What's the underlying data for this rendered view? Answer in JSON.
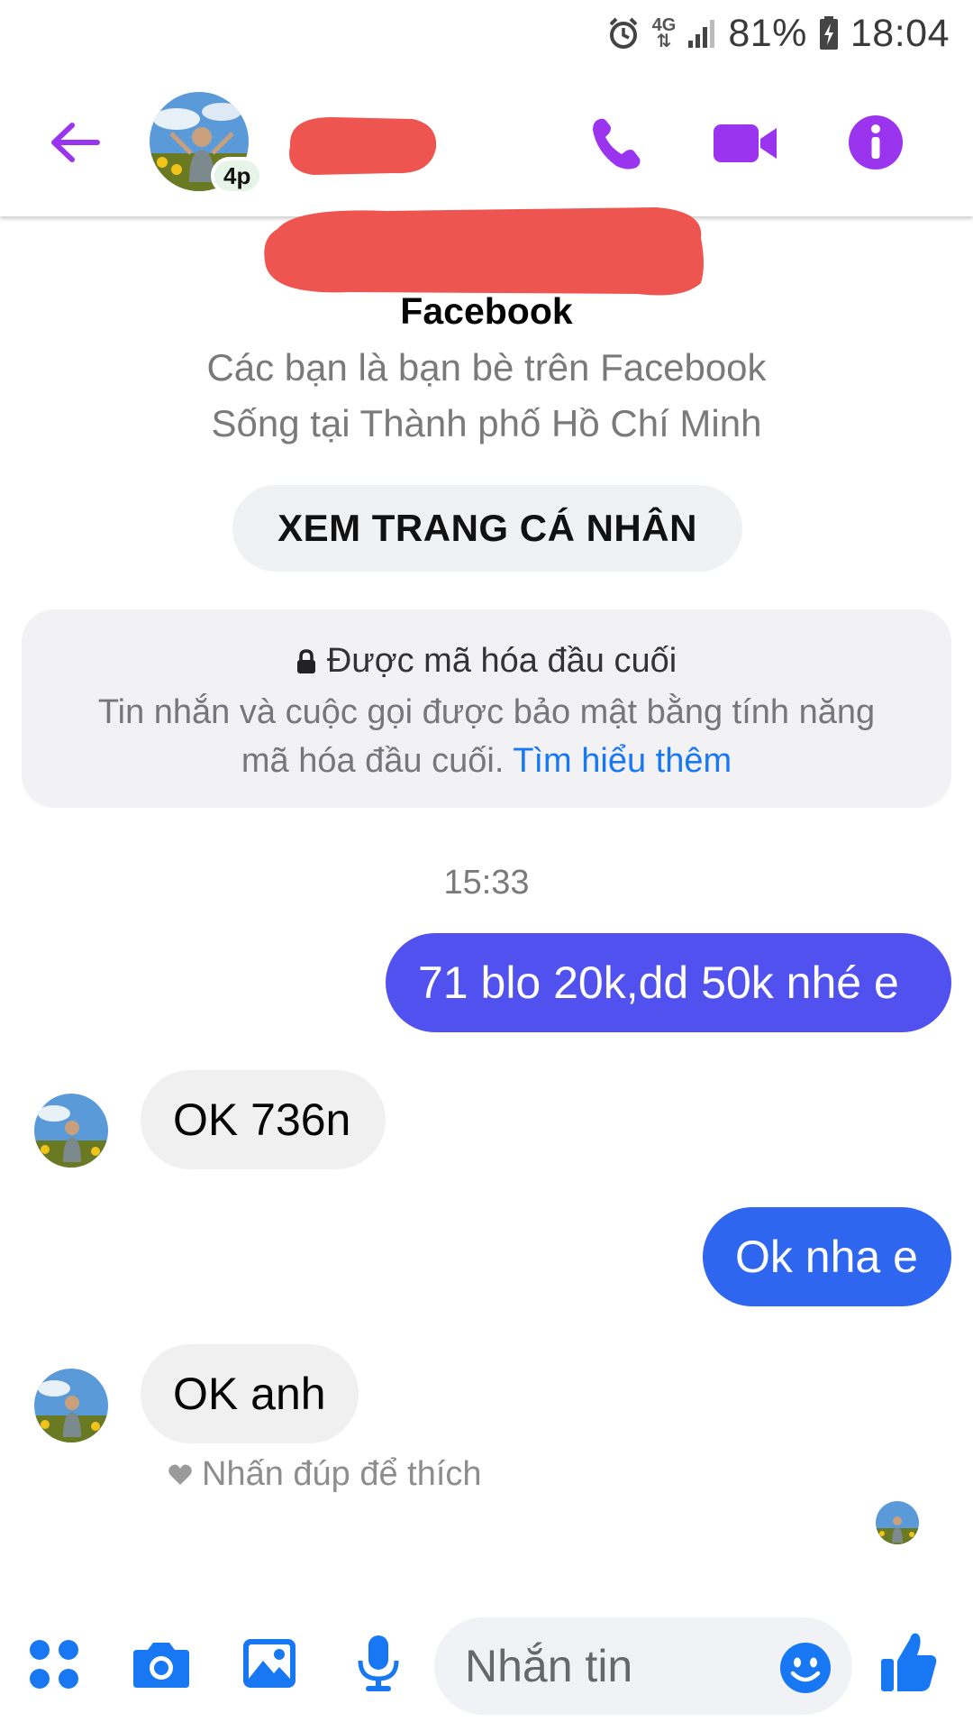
{
  "status_bar": {
    "network": "4G",
    "battery": "81%",
    "time": "18:04"
  },
  "header": {
    "active_status": "4p"
  },
  "intro": {
    "source": "Facebook",
    "friends_text": "Các bạn là bạn bè trên Facebook",
    "lives_text": "Sống tại Thành phố Hồ Chí Minh",
    "view_profile_label": "XEM TRANG CÁ NHÂN"
  },
  "encryption": {
    "title": "Được mã hóa đầu cuối",
    "desc_line1": "Tin nhắn và cuộc gọi được bảo mật bằng tính năng",
    "desc_line2": "mã hóa đầu cuối.",
    "learn_more": "Tìm hiểu thêm"
  },
  "conversation": {
    "timestamp": "15:33",
    "messages": [
      {
        "direction": "out",
        "text": "71 blo 20k,dd 50k nhé e"
      },
      {
        "direction": "in",
        "text": "OK 736n"
      },
      {
        "direction": "out",
        "text": "Ok nha e"
      },
      {
        "direction": "in",
        "text": "OK anh"
      }
    ],
    "like_hint": "Nhấn đúp để thích"
  },
  "composer": {
    "placeholder": "Nhắn tin"
  },
  "colors": {
    "accent_purple": "#9b34ef",
    "messenger_blue": "#1877f2",
    "bubble_out_1": "#5151f0",
    "bubble_out_2": "#2f66f0",
    "bubble_in": "#f0f0f0",
    "redaction": "#ee5550"
  }
}
